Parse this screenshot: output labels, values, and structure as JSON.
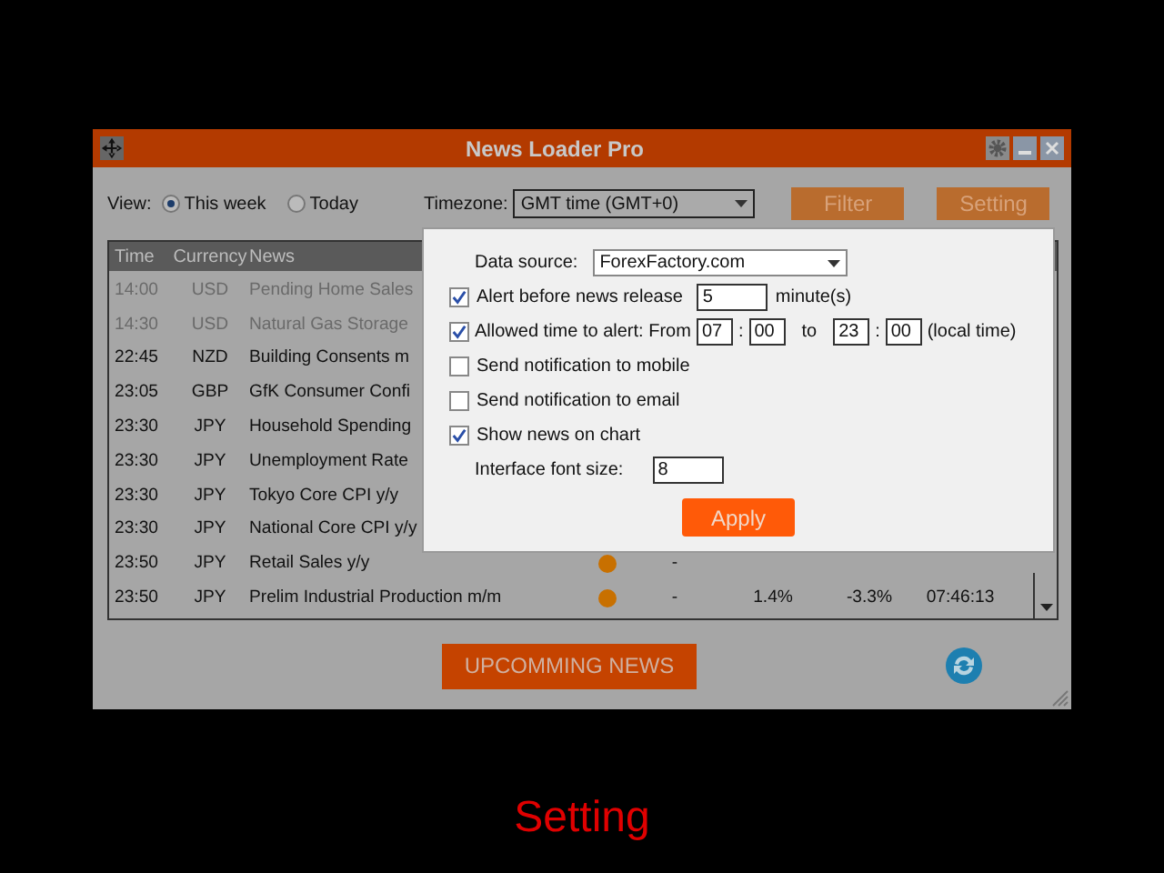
{
  "window": {
    "title": "News Loader Pro"
  },
  "toolbar": {
    "view_label": "View:",
    "view_options": [
      {
        "label": "This week",
        "selected": true
      },
      {
        "label": "Today",
        "selected": false
      }
    ],
    "timezone_label": "Timezone:",
    "timezone_value": "GMT time (GMT+0)",
    "buttons": [
      "Filter",
      "Setting"
    ]
  },
  "table": {
    "columns": [
      "Time",
      "Currency",
      "News"
    ],
    "rows": [
      {
        "time": "14:00",
        "currency": "USD",
        "news": "Pending Home Sales",
        "past": true
      },
      {
        "time": "14:30",
        "currency": "USD",
        "news": "Natural Gas Storage",
        "past": true
      },
      {
        "time": "22:45",
        "currency": "NZD",
        "news": "Building Consents m",
        "past": false
      },
      {
        "time": "23:05",
        "currency": "GBP",
        "news": "GfK Consumer Confi",
        "past": false
      },
      {
        "time": "23:30",
        "currency": "JPY",
        "news": "Household Spending",
        "past": false
      },
      {
        "time": "23:30",
        "currency": "JPY",
        "news": "Unemployment Rate",
        "past": false
      },
      {
        "time": "23:30",
        "currency": "JPY",
        "news": "Tokyo Core CPI y/y",
        "past": false
      },
      {
        "time": "23:30",
        "currency": "JPY",
        "news": "National Core CPI y/y",
        "past": false
      },
      {
        "time": "23:50",
        "currency": "JPY",
        "news": "Retail Sales y/y",
        "past": false,
        "color": "#c87000",
        "column_5": "-"
      },
      {
        "time": "23:50",
        "currency": "JPY",
        "news": "Prelim Industrial Production m/m",
        "past": false,
        "color": "#c87000",
        "column_5": "-",
        "column_6": "1.4%",
        "column_7": "-3.3%",
        "column_8": "07:46:13"
      }
    ]
  },
  "upcoming_button": "UPCOMMING NEWS",
  "settings": {
    "data_source_label": "Data source:",
    "data_source": "ForexFactory.com",
    "alert": {
      "checked": true,
      "label": "Alert before news release",
      "value": "5",
      "unit": "minute(s)"
    },
    "allowed": {
      "checked": true,
      "label": "Allowed time to alert: From",
      "from_hour": "07",
      "separator_1": ":",
      "from_min": "00",
      "to_label": "to",
      "to_hour": "23",
      "separator_2": ":",
      "to_min": "00",
      "suffix": "(local time)"
    },
    "options": [
      {
        "label": "Send notification to mobile",
        "checked": false
      },
      {
        "label": "Send notification to email",
        "checked": false
      },
      {
        "label": "Show news on chart",
        "checked": true
      }
    ],
    "font_size_label": "Interface font size:",
    "font_size": "8",
    "apply_button": "Apply"
  },
  "caption": "Setting"
}
